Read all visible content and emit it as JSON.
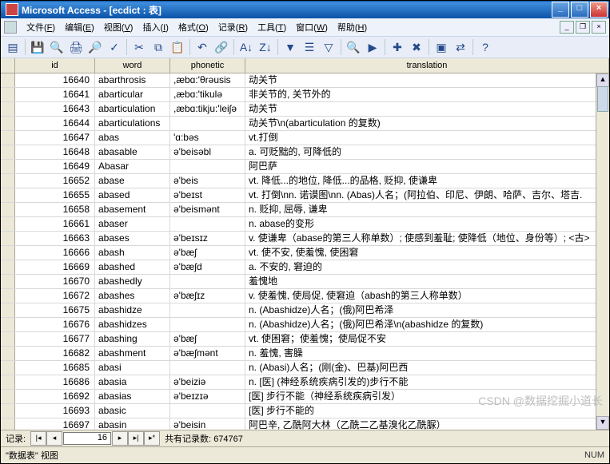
{
  "title": "Microsoft Access - [ecdict : 表]",
  "menus": [
    {
      "label": "文件",
      "u": "F"
    },
    {
      "label": "编辑",
      "u": "E"
    },
    {
      "label": "视图",
      "u": "V"
    },
    {
      "label": "插入",
      "u": "I"
    },
    {
      "label": "格式",
      "u": "O"
    },
    {
      "label": "记录",
      "u": "R"
    },
    {
      "label": "工具",
      "u": "T"
    },
    {
      "label": "窗口",
      "u": "W"
    },
    {
      "label": "帮助",
      "u": "H"
    }
  ],
  "toolbar_icons": [
    "view",
    "save",
    "search-file",
    "print",
    "preview",
    "spell",
    "cut",
    "copy",
    "paste",
    "undo",
    "link",
    "sort-asc",
    "sort-desc",
    "filter-sel",
    "filter-form",
    "filter-toggle",
    "find",
    "goto",
    "new-obj",
    "delete",
    "db-window",
    "relations",
    "help"
  ],
  "columns": {
    "id": "id",
    "word": "word",
    "phonetic": "phonetic",
    "translation": "translation"
  },
  "rows": [
    {
      "id": "16640",
      "word": "abarthrosis",
      "phon": ",æbɑ:'θrəusis",
      "tran": "动关节"
    },
    {
      "id": "16641",
      "word": "abarticular",
      "phon": ",æbɑ:'tikulə",
      "tran": "非关节的, 关节外的"
    },
    {
      "id": "16643",
      "word": "abarticulation",
      "phon": ",æbɑ:tikju:'leiʃə",
      "tran": "动关节"
    },
    {
      "id": "16644",
      "word": "abarticulations",
      "phon": "",
      "tran": "动关节\\n(abarticulation 的复数)"
    },
    {
      "id": "16647",
      "word": "abas",
      "phon": "'ɑ:bəs",
      "tran": "vt.打倒"
    },
    {
      "id": "16648",
      "word": "abasable",
      "phon": "ə'beisəbl",
      "tran": "a. 可贬黜的, 可降低的"
    },
    {
      "id": "16649",
      "word": "Abasar",
      "phon": "",
      "tran": "阿巴萨"
    },
    {
      "id": "16652",
      "word": "abase",
      "phon": "ə'beis",
      "tran": "vt. 降低...的地位, 降低...的品格, 贬抑, 使谦卑"
    },
    {
      "id": "16655",
      "word": "abased",
      "phon": "ə'beɪst",
      "tran": "vt. 打倒\\nn. 诺谟图\\nn. (Abas)人名；(阿拉伯、印尼、伊朗、哈萨、吉尔、塔吉."
    },
    {
      "id": "16658",
      "word": "abasement",
      "phon": "ə'beismənt",
      "tran": "n. 贬抑, 屈辱, 谦卑"
    },
    {
      "id": "16661",
      "word": "abaser",
      "phon": "",
      "tran": "n. abase的变形"
    },
    {
      "id": "16663",
      "word": "abases",
      "phon": "ə'beɪsɪz",
      "tran": "v. 使谦卑（abase的第三人称单数）; 使感到羞耻; 使降低（地位、身份等）; <古>"
    },
    {
      "id": "16666",
      "word": "abash",
      "phon": "ə'bæʃ",
      "tran": "vt. 使不安, 使羞愧, 使困窘"
    },
    {
      "id": "16669",
      "word": "abashed",
      "phon": "ə'bæʃd",
      "tran": "a. 不安的, 窘迫的"
    },
    {
      "id": "16670",
      "word": "abashedly",
      "phon": "",
      "tran": "羞愧地"
    },
    {
      "id": "16672",
      "word": "abashes",
      "phon": "ə'bæʃɪz",
      "tran": "v. 使羞愧, 使局促, 使窘迫（abash的第三人称单数）"
    },
    {
      "id": "16675",
      "word": "abashidze",
      "phon": "",
      "tran": "n. (Abashidze)人名；(俄)阿巴希泽"
    },
    {
      "id": "16676",
      "word": "abashidzes",
      "phon": "",
      "tran": "n. (Abashidze)人名；(俄)阿巴希泽\\n(abashidze 的复数)"
    },
    {
      "id": "16677",
      "word": "abashing",
      "phon": "ə'bæʃ",
      "tran": "vt. 使困窘；使羞愧；使局促不安"
    },
    {
      "id": "16682",
      "word": "abashment",
      "phon": "ə'bæʃmənt",
      "tran": "n. 羞愧, 害臊"
    },
    {
      "id": "16685",
      "word": "abasi",
      "phon": "",
      "tran": "n. (Abasi)人名；(刚(金)、巴基)阿巴西"
    },
    {
      "id": "16686",
      "word": "abasia",
      "phon": "ə'beiziə",
      "tran": "n. [医] (神经系统疾病引发的)步行不能"
    },
    {
      "id": "16692",
      "word": "abasias",
      "phon": "ə'beɪzɪə",
      "tran": "[医] 步行不能（神经系统疾病引发）"
    },
    {
      "id": "16693",
      "word": "abasic",
      "phon": "",
      "tran": "[医] 步行不能的"
    },
    {
      "id": "16697",
      "word": "abasin",
      "phon": "ə'beisin",
      "tran": "阿巴辛, 乙酰阿大林（乙酰二乙基溴化乙酰脲）"
    }
  ],
  "nav": {
    "label": "记录:",
    "current": "16",
    "total_label": "共有记录数:",
    "total": "674767"
  },
  "status": {
    "left": "\"数据表\" 视图"
  },
  "watermark": "CSDN @数据挖掘小道长"
}
